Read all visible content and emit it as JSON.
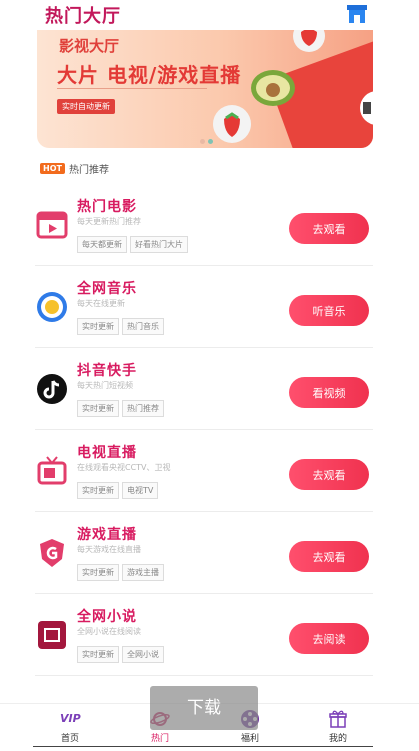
{
  "header": {
    "title": "热门大厅"
  },
  "banner": {
    "title": "影视大厅",
    "subtitle": "大片 电视/游戏直播",
    "tag": "实时自动更新",
    "colors": {
      "accent": "#e33a36"
    }
  },
  "section": {
    "hot_badge": "HOT",
    "label": "热门推荐"
  },
  "items": [
    {
      "name": "热门电影",
      "desc": "每天更新热门推荐",
      "tags": [
        "每天都更新",
        "好看热门大片"
      ],
      "action": "去观看",
      "icon": "movie-icon"
    },
    {
      "name": "全网音乐",
      "desc": "每天在线更新",
      "tags": [
        "实时更新",
        "热门音乐"
      ],
      "action": "听音乐",
      "icon": "music-icon"
    },
    {
      "name": "抖音快手",
      "desc": "每天热门短视频",
      "tags": [
        "实时更新",
        "热门推荐"
      ],
      "action": "看视频",
      "icon": "tiktok-icon"
    },
    {
      "name": "电视直播",
      "desc": "在线观看央视CCTV、卫视",
      "tags": [
        "实时更新",
        "电视TV"
      ],
      "action": "去观看",
      "icon": "tv-icon"
    },
    {
      "name": "游戏直播",
      "desc": "每天游戏在线直播",
      "tags": [
        "实时更新",
        "游戏主播"
      ],
      "action": "去观看",
      "icon": "game-icon"
    },
    {
      "name": "全网小说",
      "desc": "全网小说在线阅读",
      "tags": [
        "实时更新",
        "全网小说"
      ],
      "action": "去阅读",
      "icon": "novel-icon"
    }
  ],
  "tabbar": {
    "tabs": [
      {
        "label": "首页",
        "icon": "vip-icon"
      },
      {
        "label": "热门",
        "icon": "planet-icon"
      },
      {
        "label": "福利",
        "icon": "film-reel-icon"
      },
      {
        "label": "我的",
        "icon": "gift-icon"
      }
    ],
    "vip_text": "VIP"
  },
  "overlay": {
    "download": "下载"
  }
}
